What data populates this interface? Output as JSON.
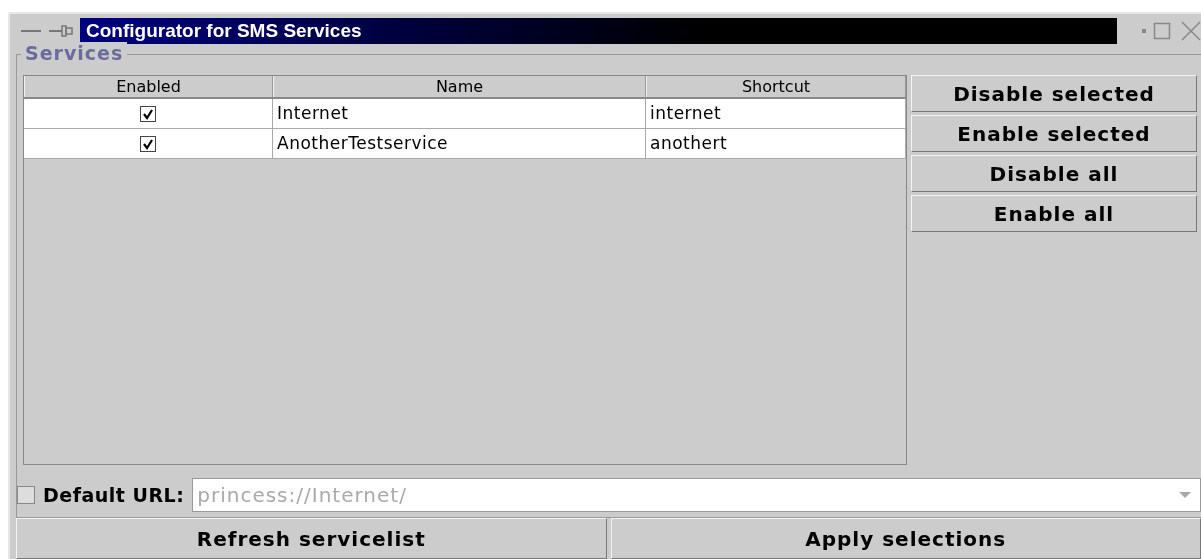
{
  "window": {
    "title": "Configurator for SMS Services"
  },
  "group": {
    "title": "Services"
  },
  "table": {
    "columns": [
      "Enabled",
      "Name",
      "Shortcut"
    ],
    "rows": [
      {
        "enabled": true,
        "name": "Internet",
        "shortcut": "internet"
      },
      {
        "enabled": true,
        "name": "AnotherTestservice",
        "shortcut": "anothert"
      }
    ]
  },
  "side_buttons": [
    "Disable selected",
    "Enable selected",
    "Disable all",
    "Enable all"
  ],
  "default_url": {
    "label": "Default URL:",
    "checked": false,
    "value": "princess://Internet/",
    "disabled": true
  },
  "bottom_buttons": [
    "Refresh servicelist",
    "Apply selections"
  ]
}
